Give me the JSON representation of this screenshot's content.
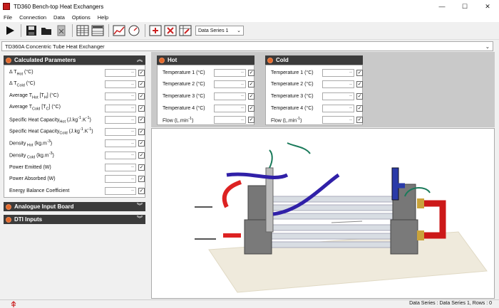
{
  "window": {
    "title": "TD360 Bench-top Heat Exchangers",
    "minimize": "—",
    "maximize": "☐",
    "close": "✕"
  },
  "menu": [
    "File",
    "Connection",
    "Data",
    "Options",
    "Help"
  ],
  "toolbar": {
    "series_value": "Data Series 1"
  },
  "device_select": "TD360A Concentric Tube Heat Exchanger",
  "calculated": {
    "title": "Calculated Parameters",
    "rows": [
      {
        "label": "Δ T",
        "sub": "Hot",
        "unit": " (°C)"
      },
      {
        "label": "Δ T",
        "sub": "Cold",
        "unit": " (°C)"
      },
      {
        "label": "Average T",
        "sub": "Hot",
        "unit": " [T",
        "sub2": "H",
        "unit2": "] (°C)"
      },
      {
        "label": "Average T",
        "sub": "Cold",
        "unit": " [T",
        "sub2": "C",
        "unit2": "] (°C)"
      },
      {
        "label": "Specific Heat Capacity",
        "sub": "Hot",
        "unit": " (J.kg",
        "sup": "-1",
        "unit2": ".K",
        "sup2": "-1",
        "unit3": ")"
      },
      {
        "label": "Specific Heat Capacity",
        "sub": "Cold",
        "unit": " (J.kg",
        "sup": "-1",
        "unit2": ".K",
        "sup2": "-1",
        "unit3": ")"
      },
      {
        "label": "Density",
        "sub": " Hot",
        "unit": " (kg.m",
        "sup": "-3",
        "unit2": ")"
      },
      {
        "label": "Density",
        "sub": " Cold",
        "unit": " (kg.m",
        "sup": "-3",
        "unit2": ")"
      },
      {
        "label": "Power Emitted",
        "unit": " (W)"
      },
      {
        "label": "Power Absorbed",
        "unit": " (W)"
      },
      {
        "label": "Energy Balance Coefficient"
      }
    ]
  },
  "analogue": {
    "title": "Analogue Input Board"
  },
  "dti": {
    "title": "DTI Inputs"
  },
  "hot": {
    "title": "Hot",
    "rows": [
      {
        "label": "Temperature 1",
        "unit": " (°C)"
      },
      {
        "label": "Temperature 2",
        "unit": " (°C)"
      },
      {
        "label": "Temperature 3",
        "unit": " (°C)"
      },
      {
        "label": "Temperature 4",
        "unit": " (°C)"
      },
      {
        "label": "Flow",
        "unit": " (L.min",
        "sup": "-1",
        "unit2": ")"
      }
    ]
  },
  "cold": {
    "title": "Cold",
    "rows": [
      {
        "label": "Temperature 1",
        "unit": " (°C)"
      },
      {
        "label": "Temperature 2",
        "unit": " (°C)"
      },
      {
        "label": "Temperature 3",
        "unit": " (°C)"
      },
      {
        "label": "Temperature 4",
        "unit": " (°C)"
      },
      {
        "label": "Flow",
        "unit": " (L.min",
        "sup": "-1",
        "unit2": ")"
      }
    ]
  },
  "field_value": "--",
  "check_mark": "✓",
  "status": {
    "text": "Data Series : Data Series 1,  Rows : 0"
  }
}
